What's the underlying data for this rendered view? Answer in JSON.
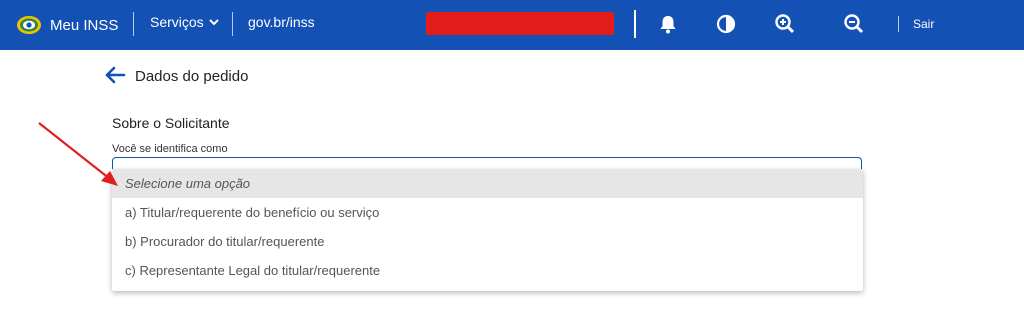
{
  "header": {
    "brand_label": "Meu INSS",
    "services_label": "Serviços",
    "gov_link": "gov.br/inss",
    "logout_label": "Sair",
    "icons": [
      "bell-icon",
      "contrast-icon",
      "zoom-in-icon",
      "zoom-out-icon"
    ],
    "colors": {
      "bar": "#1351b4",
      "redaction": "#e21b1b"
    }
  },
  "page": {
    "title": "Dados do pedido",
    "section_title": "Sobre o Solicitante",
    "field_label": "Você se identifica como"
  },
  "dropdown": {
    "placeholder": "Selecione uma opção",
    "options": [
      "a) Titular/requerente do benefício ou serviço",
      "b) Procurador do titular/requerente",
      "c) Representante Legal do titular/requerente"
    ]
  },
  "annotation": {
    "arrow_color": "#e02020"
  }
}
